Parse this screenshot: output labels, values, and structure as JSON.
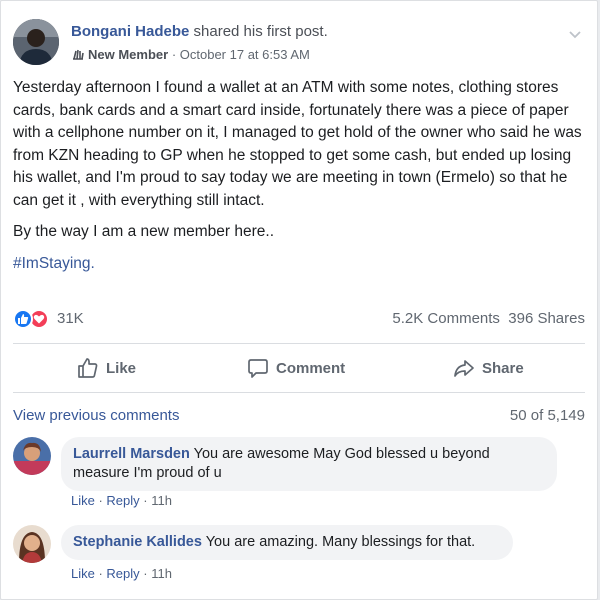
{
  "post": {
    "author": "Bongani Hadebe",
    "shared_text": " shared his first post.",
    "badge": "New Member",
    "separator": " · ",
    "timestamp": "October 17 at 6:53 AM",
    "paragraphs": [
      "Yesterday afternoon I found a wallet at an ATM with some notes, clothing stores cards, bank cards and a smart card inside, fortunately there was a piece of paper with a cellphone number on it, I managed to get hold of the owner who said he was from KZN heading to GP when he stopped to get some cash, but ended up losing his wallet, and I'm proud to say today we are meeting in town (Ermelo) so that he can get it , with everything still intact.",
      "By the way I am a new member here.."
    ],
    "hashtag": "#ImStaying.",
    "reactions_count": "31K",
    "comments_count": "5.2K Comments",
    "shares_count": "396 Shares"
  },
  "actions": {
    "like": "Like",
    "comment": "Comment",
    "share": "Share"
  },
  "comments_section": {
    "view_previous": "View previous comments",
    "pager": "50 of 5,149",
    "comments": [
      {
        "author": "Laurrell Marsden",
        "text": "You are awesome May God blessed u beyond measure I'm proud of u",
        "like": "Like",
        "reply": "Reply",
        "time": "11h"
      },
      {
        "author": "Stephanie Kallides",
        "text": "You are amazing. Many blessings for that.",
        "like": "Like",
        "reply": "Reply",
        "time": "11h"
      }
    ],
    "dot": " · "
  },
  "icons": {
    "expand": "chevron-down-icon",
    "badge": "waving-hand-icon",
    "reactions": [
      "like-reaction-icon",
      "love-reaction-icon"
    ],
    "actions": [
      "thumbs-up-icon",
      "speech-bubble-icon",
      "share-arrow-icon"
    ]
  },
  "colors": {
    "link": "#385898",
    "like_blue": "#1877f2",
    "love_red": "#f33e58",
    "bubble_bg": "#f2f3f5",
    "muted": "#606770"
  }
}
